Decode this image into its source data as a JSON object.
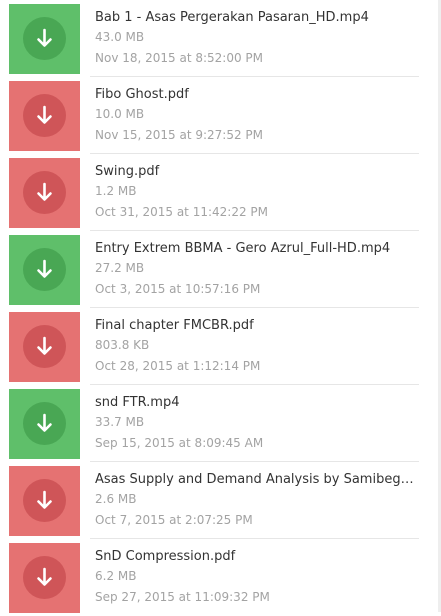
{
  "files": [
    {
      "name": "Bab 1 - Asas Pergerakan Pasaran_HD.mp4",
      "size": "43.0 MB",
      "date": "Nov 18, 2015 at 8:52:00 PM",
      "type": "video",
      "color": "#5fbf6a",
      "icon": "download-arrow-icon"
    },
    {
      "name": "Fibo Ghost.pdf",
      "size": "10.0 MB",
      "date": "Nov 15, 2015 at 9:27:52 PM",
      "type": "pdf",
      "color": "#e57272",
      "icon": "download-arrow-icon"
    },
    {
      "name": "Swing.pdf",
      "size": "1.2 MB",
      "date": "Oct 31, 2015 at 11:42:22 PM",
      "type": "pdf",
      "color": "#e57272",
      "icon": "download-arrow-icon"
    },
    {
      "name": "Entry Extrem BBMA - Gero Azrul_Full-HD.mp4",
      "size": "27.2 MB",
      "date": "Oct 3, 2015 at 10:57:16 PM",
      "type": "video",
      "color": "#5fbf6a",
      "icon": "download-arrow-icon"
    },
    {
      "name": "Final chapter FMCBR.pdf",
      "size": "803.8 KB",
      "date": "Oct 28, 2015 at 1:12:14 PM",
      "type": "pdf",
      "color": "#e57272",
      "icon": "download-arrow-icon"
    },
    {
      "name": "snd FTR.mp4",
      "size": "33.7 MB",
      "date": "Sep 15, 2015 at 8:09:45 AM",
      "type": "video",
      "color": "#5fbf6a",
      "icon": "download-arrow-icon"
    },
    {
      "name": "Asas Supply and Demand Analysis by Samibegood...",
      "size": "2.6 MB",
      "date": "Oct 7, 2015 at 2:07:25 PM",
      "type": "pdf",
      "color": "#e57272",
      "icon": "download-arrow-icon"
    },
    {
      "name": "SnD Compression.pdf",
      "size": "6.2 MB",
      "date": "Sep 27, 2015 at 11:09:32 PM",
      "type": "pdf",
      "color": "#e57272",
      "icon": "download-arrow-icon"
    }
  ]
}
